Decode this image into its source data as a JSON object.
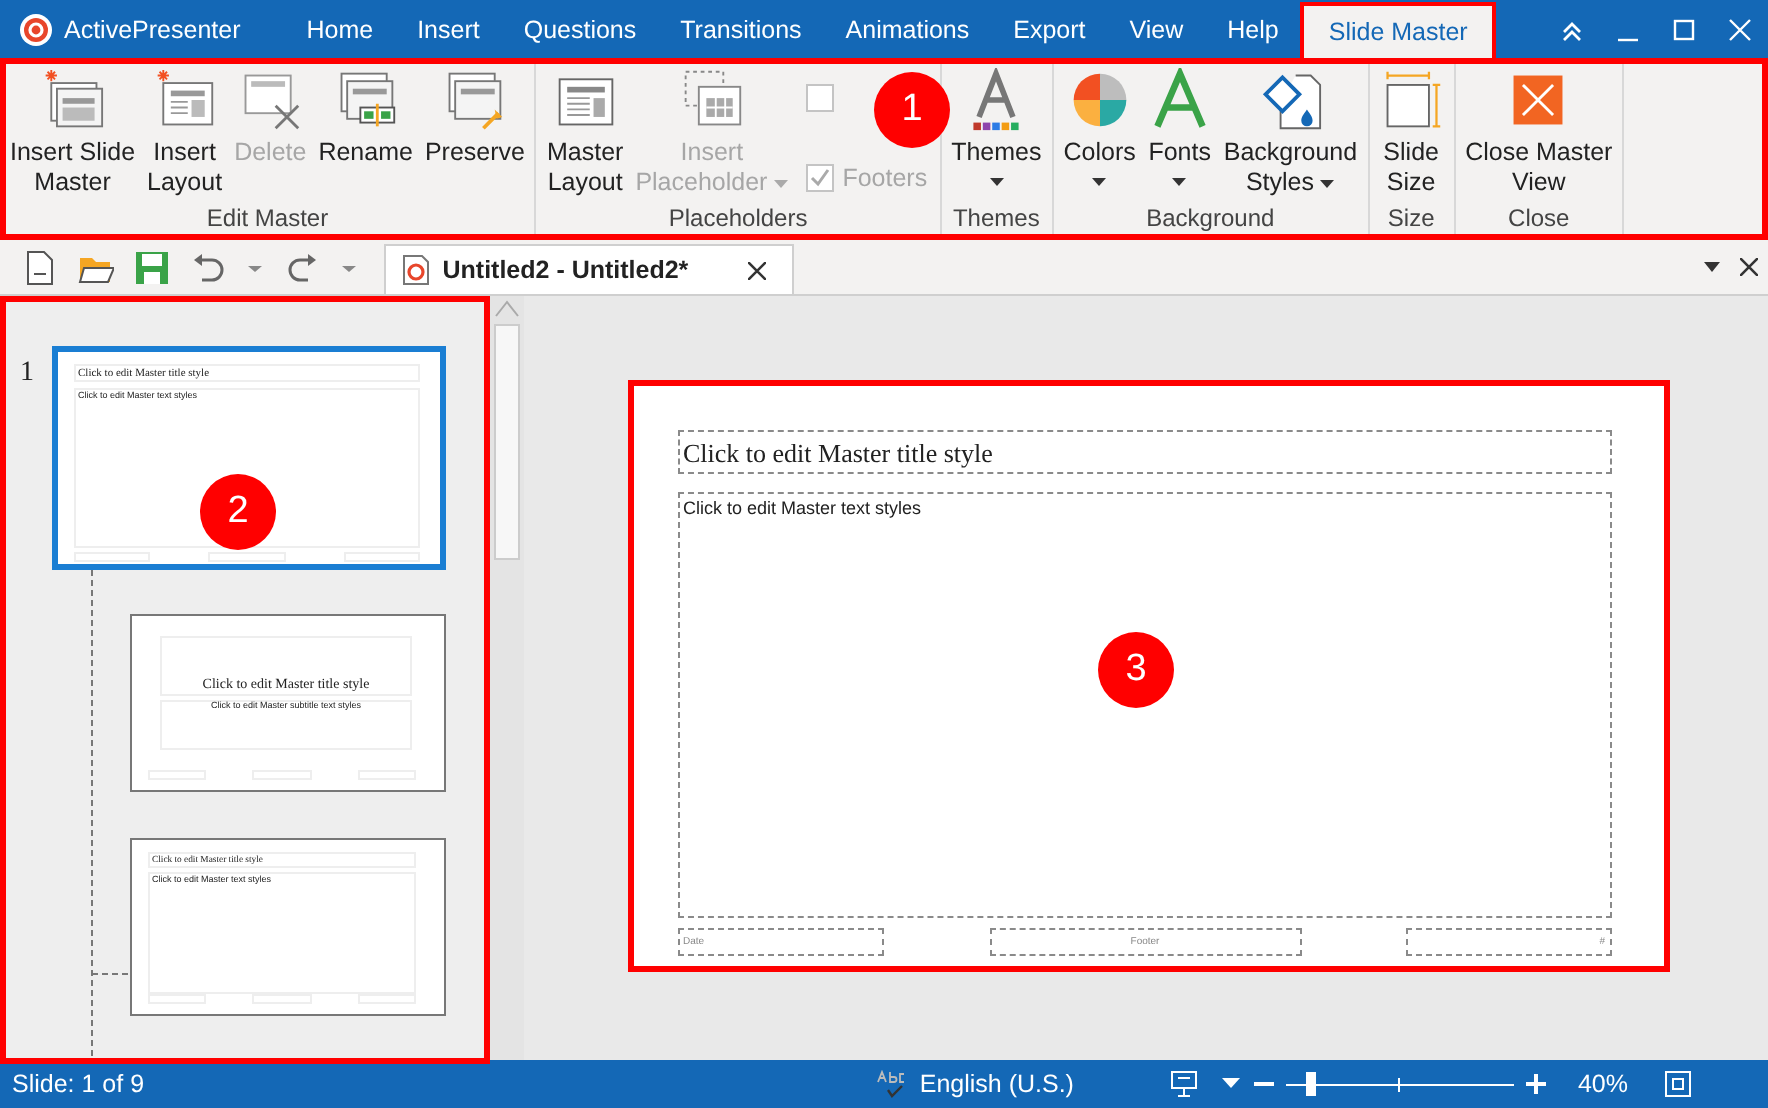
{
  "window": {
    "app_name": "ActivePresenter",
    "tabs": [
      {
        "label": "Home",
        "selected": false
      },
      {
        "label": "Insert",
        "selected": false
      },
      {
        "label": "Questions",
        "selected": false
      },
      {
        "label": "Transitions",
        "selected": false
      },
      {
        "label": "Animations",
        "selected": false
      },
      {
        "label": "Export",
        "selected": false
      },
      {
        "label": "View",
        "selected": false
      },
      {
        "label": "Help",
        "selected": false
      },
      {
        "label": "Slide Master",
        "selected": true
      }
    ]
  },
  "ribbon": {
    "groups": [
      {
        "label": "Edit Master",
        "buttons": [
          {
            "lines": [
              "Insert Slide",
              "Master"
            ],
            "disabled": false,
            "dropdown": false
          },
          {
            "lines": [
              "Insert",
              "Layout"
            ],
            "disabled": false,
            "dropdown": false
          },
          {
            "lines": [
              "Delete"
            ],
            "disabled": true,
            "dropdown": false
          },
          {
            "lines": [
              "Rename"
            ],
            "disabled": false,
            "dropdown": false
          },
          {
            "lines": [
              "Preserve"
            ],
            "disabled": false,
            "dropdown": false
          }
        ]
      },
      {
        "label": "Placeholders",
        "buttons": [
          {
            "lines": [
              "Master",
              "Layout"
            ],
            "disabled": false,
            "dropdown": false
          },
          {
            "lines": [
              "Insert",
              "Placeholder"
            ],
            "disabled": true,
            "dropdown": true
          }
        ],
        "checkboxes": [
          {
            "checked": false,
            "disabled": true
          },
          {
            "label": "Footers",
            "checked": true,
            "disabled": true
          }
        ]
      },
      {
        "label": "Themes",
        "buttons": [
          {
            "lines": [
              "Themes"
            ],
            "disabled": false,
            "dropdown": true
          }
        ]
      },
      {
        "label": "Background",
        "buttons": [
          {
            "lines": [
              "Colors"
            ],
            "disabled": false,
            "dropdown": true
          },
          {
            "lines": [
              "Fonts"
            ],
            "disabled": false,
            "dropdown": true
          },
          {
            "lines": [
              "Background",
              "Styles"
            ],
            "disabled": false,
            "dropdown": true
          }
        ]
      },
      {
        "label": "Size",
        "buttons": [
          {
            "lines": [
              "Slide",
              "Size"
            ],
            "disabled": false,
            "dropdown": false
          }
        ]
      },
      {
        "label": "Close",
        "buttons": [
          {
            "lines": [
              "Close Master",
              "View"
            ],
            "disabled": false,
            "dropdown": false
          }
        ]
      }
    ]
  },
  "document_tab": {
    "title": "Untitled2 - Untitled2*"
  },
  "thumbnails": [
    {
      "number": "1",
      "kind": "master",
      "selected": true,
      "title": "Click to edit Master title style",
      "body": "Click to edit Master text styles"
    },
    {
      "kind": "title",
      "selected": false,
      "title": "Click to edit Master title style",
      "body": "Click to edit Master subtitle text styles"
    },
    {
      "kind": "content",
      "selected": false,
      "title": "Click to edit Master title style",
      "body": "Click to edit Master text styles"
    }
  ],
  "slide": {
    "title": "Click to edit Master title style",
    "body": "Click to edit Master text styles",
    "footers": [
      "Date",
      "Footer",
      "#"
    ]
  },
  "status_bar": {
    "slide": "Slide: 1 of 9",
    "language": "English (U.S.)",
    "zoom": {
      "level": 0.09,
      "reading": "40%"
    }
  },
  "callouts": [
    {
      "number": "1"
    },
    {
      "number": "2"
    },
    {
      "number": "3"
    }
  ]
}
